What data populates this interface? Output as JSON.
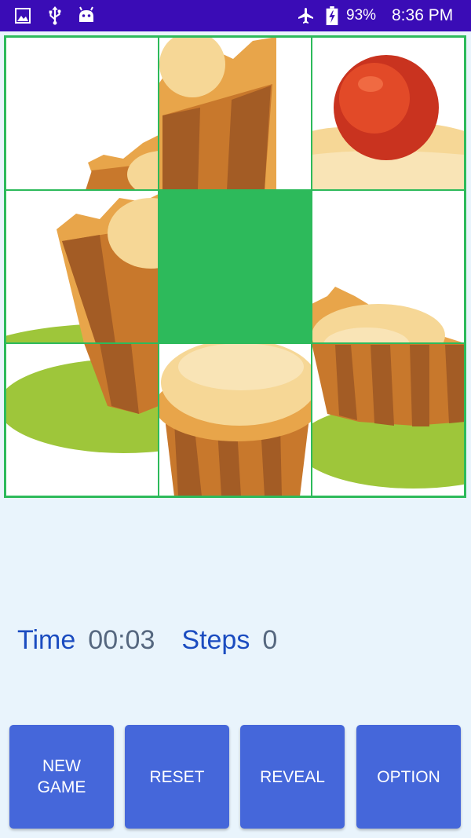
{
  "status_bar": {
    "icons": [
      "image-icon",
      "usb-icon",
      "android-icon",
      "airplane-mode-icon",
      "battery-charging-icon"
    ],
    "battery_percent": "93%",
    "clock": "8:36 PM"
  },
  "board": {
    "rows": 3,
    "cols": 3,
    "empty_tile": {
      "row": 1,
      "col": 1
    },
    "picture": "cupcake-with-red-cherry",
    "colors": {
      "grid_line": "#2DBA5B",
      "empty_tile": "#2DBA5B",
      "cake_wrapper": "#D9852F",
      "cake_wrapper_dark": "#9C5624",
      "frosting": "#F6D796",
      "cherry": "#D8351E",
      "plate": "#9EC63A"
    }
  },
  "stats": {
    "time_label": "Time",
    "time_value": "00:03",
    "steps_label": "Steps",
    "steps_value": "0"
  },
  "buttons": {
    "new_game": "NEW GAME",
    "reset": "RESET",
    "reveal": "REVEAL",
    "option": "OPTION"
  },
  "theme": {
    "background": "#E9F4FC",
    "status_bar": "#3A0CB6",
    "button": "#4567DA",
    "label_blue": "#1B4CC0",
    "value_grey": "#55677F"
  }
}
